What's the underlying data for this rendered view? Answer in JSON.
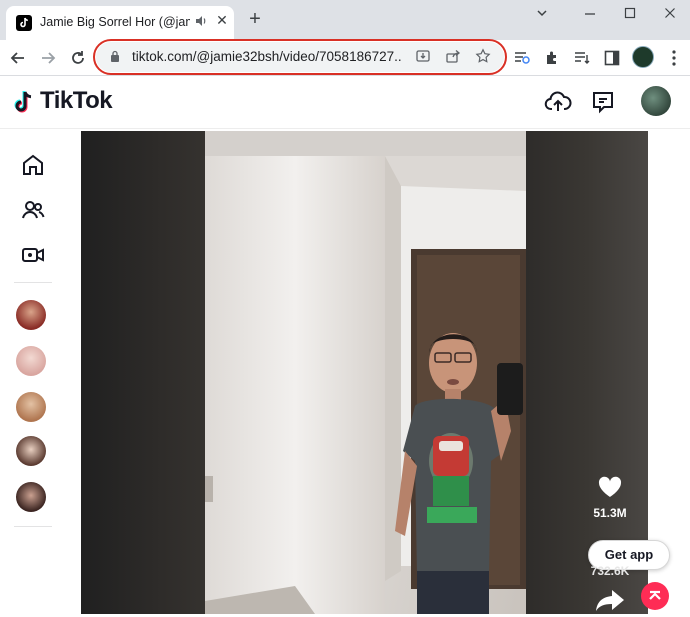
{
  "browser": {
    "tab_title": "Jamie Big Sorrel Hor (@jamie",
    "tab_close": "✕",
    "new_tab": "+",
    "url": "tiktok.com/@jamie32bsh/video/7058186727...",
    "window_controls": {
      "minimize": "⌄",
      "restore": "—",
      "maximize": "☐",
      "close": "✕"
    }
  },
  "tiktok": {
    "logo_text": "TikTok",
    "like_count": "51.3M",
    "share_count": "732.6K",
    "get_app_label": "Get app"
  },
  "colors": {
    "accent": "#fe2c55",
    "highlight_border": "#d93025"
  }
}
